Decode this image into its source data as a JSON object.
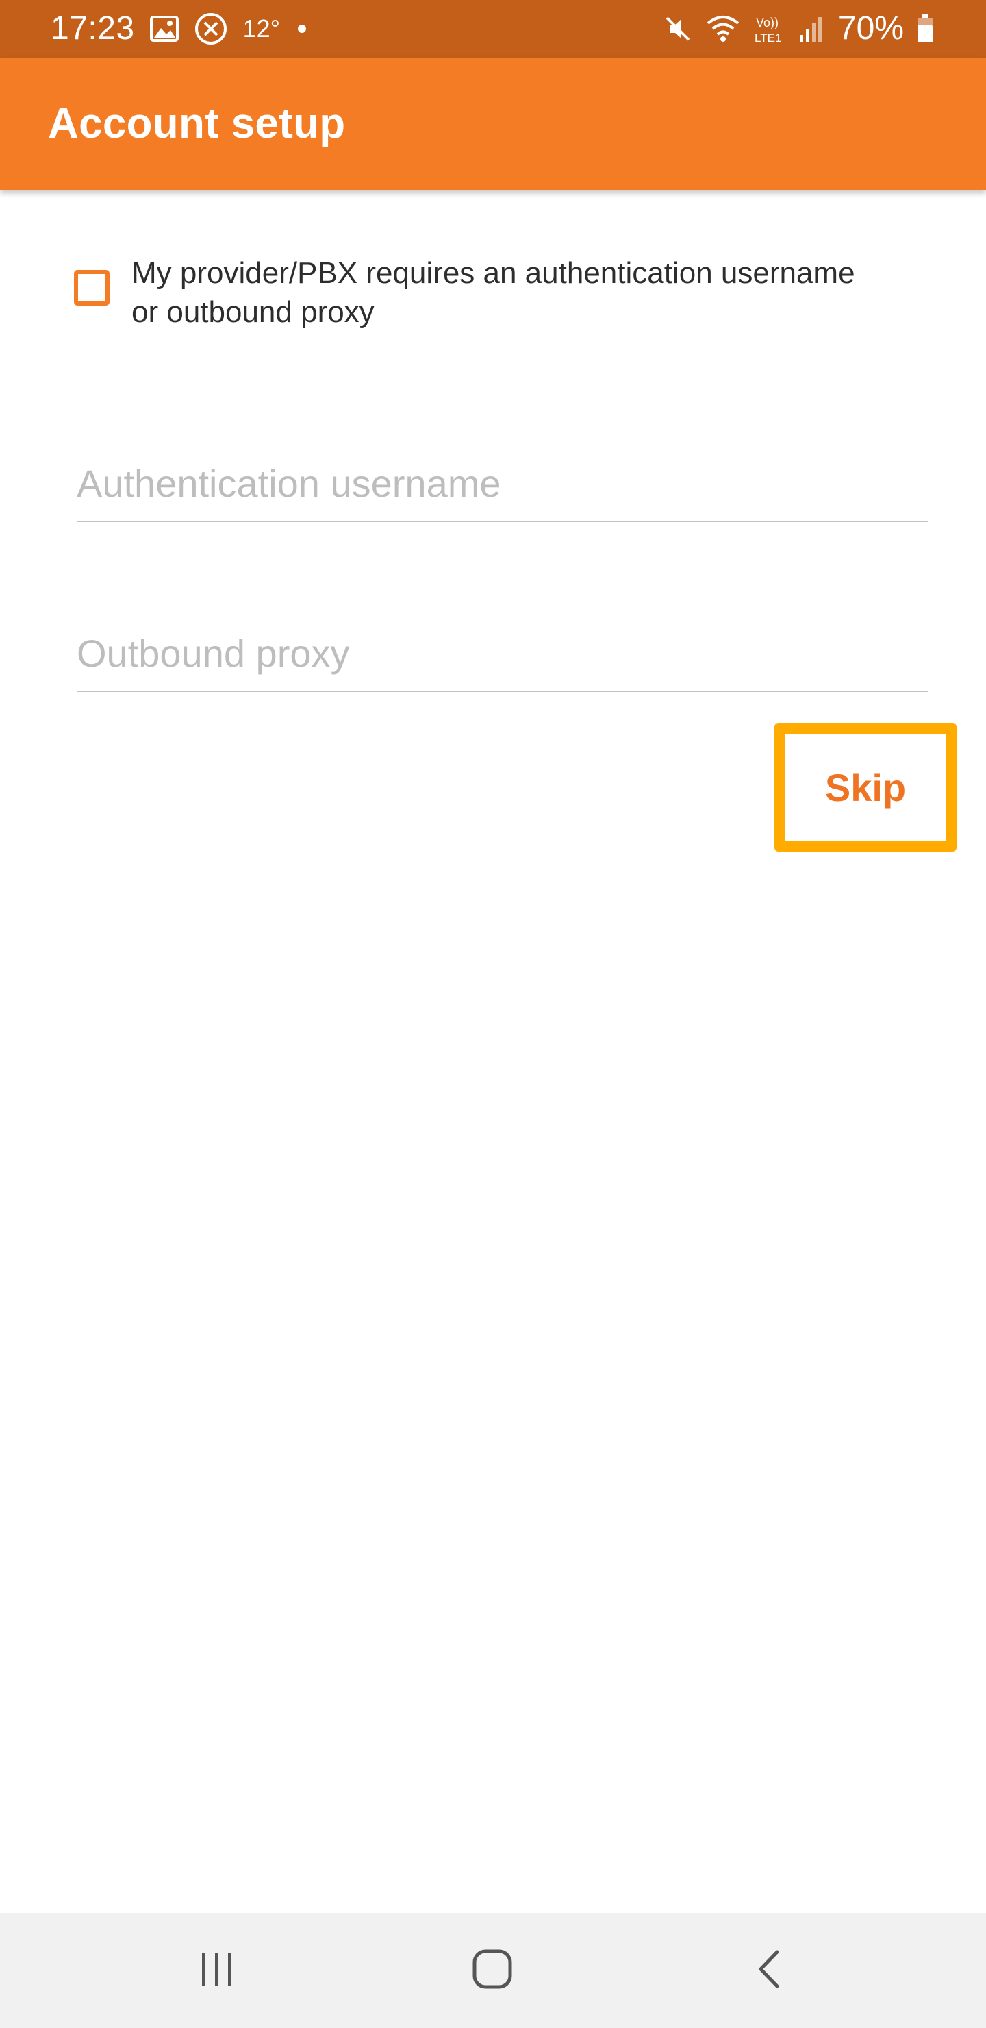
{
  "status_bar": {
    "time": "17:23",
    "temperature": "12°",
    "battery": "70%",
    "left_icons": [
      "gallery-icon",
      "blocked-icon",
      "notification-dot-icon"
    ],
    "right_icons": [
      "mute-icon",
      "wifi-icon",
      "volte-lte-icon",
      "signal-icon",
      "battery-icon"
    ]
  },
  "app_bar": {
    "title": "Account setup",
    "color": "#f47c24"
  },
  "form": {
    "checkbox": {
      "label": "My provider/PBX requires an authentication username or outbound proxy",
      "checked": false
    },
    "auth_username": {
      "placeholder": "Authentication username",
      "value": ""
    },
    "outbound_proxy": {
      "placeholder": "Outbound proxy",
      "value": ""
    },
    "skip_label": "Skip"
  },
  "nav_bar": {
    "icons": [
      "recent-apps-icon",
      "home-icon",
      "back-icon"
    ]
  },
  "colors": {
    "accent": "#f47c24",
    "status_bar": "#c45f1a",
    "highlight": "#ffab00"
  }
}
